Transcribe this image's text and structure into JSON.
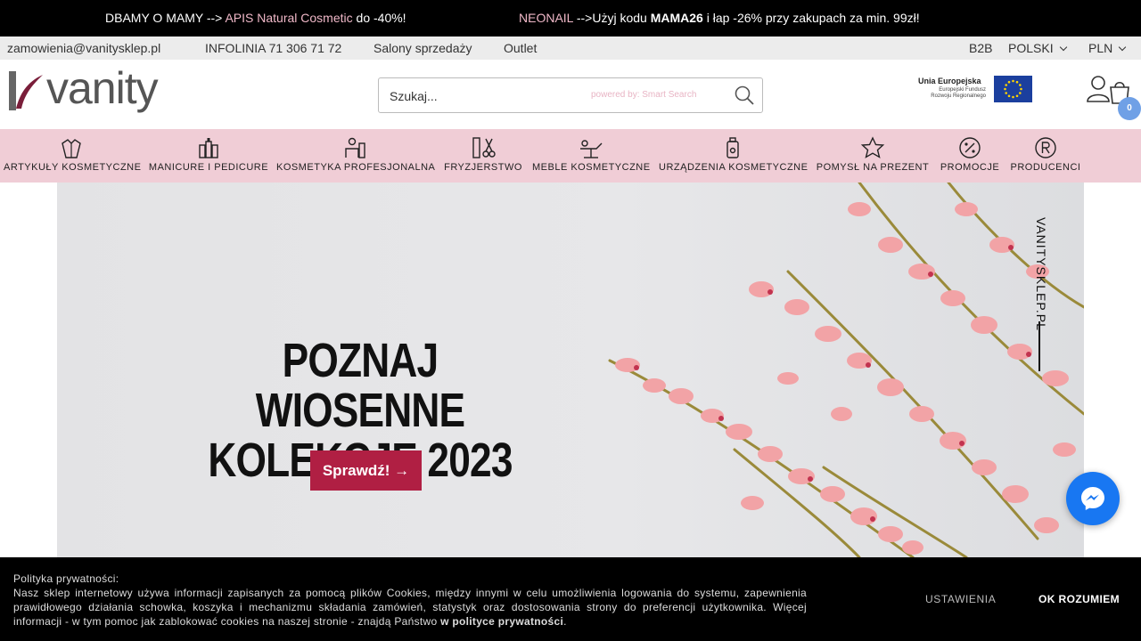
{
  "promo": {
    "left": {
      "prefix": "DBAMY O MAMY -->",
      "highlight": "APIS Natural Cosmetic",
      "suffix": "do -40%!"
    },
    "right": {
      "highlight": "NEONAIL",
      "text1": "-->Użyj kodu",
      "code": "MAMA26",
      "text2": "i łap -26% przy zakupach za min. 99zł!"
    }
  },
  "infobar": {
    "email": "zamowienia@vanitysklep.pl",
    "hotline": "INFOLINIA 71 306 71 72",
    "salons": "Salony sprzedaży",
    "outlet": "Outlet",
    "b2b": "B2B",
    "language": "POLSKI",
    "currency": "PLN"
  },
  "header": {
    "logo_text": "vanity",
    "search": {
      "placeholder": "Szukaj...",
      "powered": "powered by: Smart Search"
    },
    "eu": {
      "title": "Unia Europejska",
      "line1": "Europejski Fundusz",
      "line2": "Rozwoju Regionalnego"
    },
    "cart_count": "0"
  },
  "categories": [
    {
      "label": "ARTYKUŁY KOSMETYCZNE",
      "icon": "cosmetics-icon"
    },
    {
      "label": "MANICURE I PEDICURE",
      "icon": "nail-polish-icon"
    },
    {
      "label": "KOSMETYKA PROFESJONALNA",
      "icon": "professional-icon"
    },
    {
      "label": "FRYZJERSTWO",
      "icon": "scissors-comb-icon"
    },
    {
      "label": "MEBLE KOSMETYCZNE",
      "icon": "salon-bed-icon"
    },
    {
      "label": "URZĄDZENIA KOSMETYCZNE",
      "icon": "device-icon"
    },
    {
      "label": "POMYSŁ NA PREZENT",
      "icon": "star-icon"
    },
    {
      "label": "PROMOCJE",
      "icon": "percent-badge-icon"
    },
    {
      "label": "PRODUCENCI",
      "icon": "registered-icon"
    }
  ],
  "hero": {
    "title_line1": "POZNAJ WIOSENNE",
    "title_line2": "KOLEKCJE 2023",
    "button": "Sprawdź! →",
    "vertical_text": "VANITYSKLEP.PL"
  },
  "cookie": {
    "heading": "Polityka prywatności:",
    "body": "Nasz sklep internetowy używa informacji zapisanych za pomocą plików Cookies, między innymi w celu umożliwienia logowania do systemu, zapewnienia prawidłowego działania schowka, koszyka i mechanizmu składania zamówień, statystyk oraz dostosowania strony do preferencji użytkownika. Więcej informacji - w tym pomoc jak zablokować cookies na naszej stronie - znajdą Państwo",
    "link": "w polityce prywatności",
    "end": ".",
    "settings": "USTAWIENIA",
    "ok": "OK ROZUMIEM"
  },
  "colors": {
    "promo_pink": "#f0b8c8",
    "nav_bg": "#f0cdd6",
    "cta": "#b01f43",
    "messenger": "#1877f2",
    "cart_badge": "#6fa0e6"
  }
}
